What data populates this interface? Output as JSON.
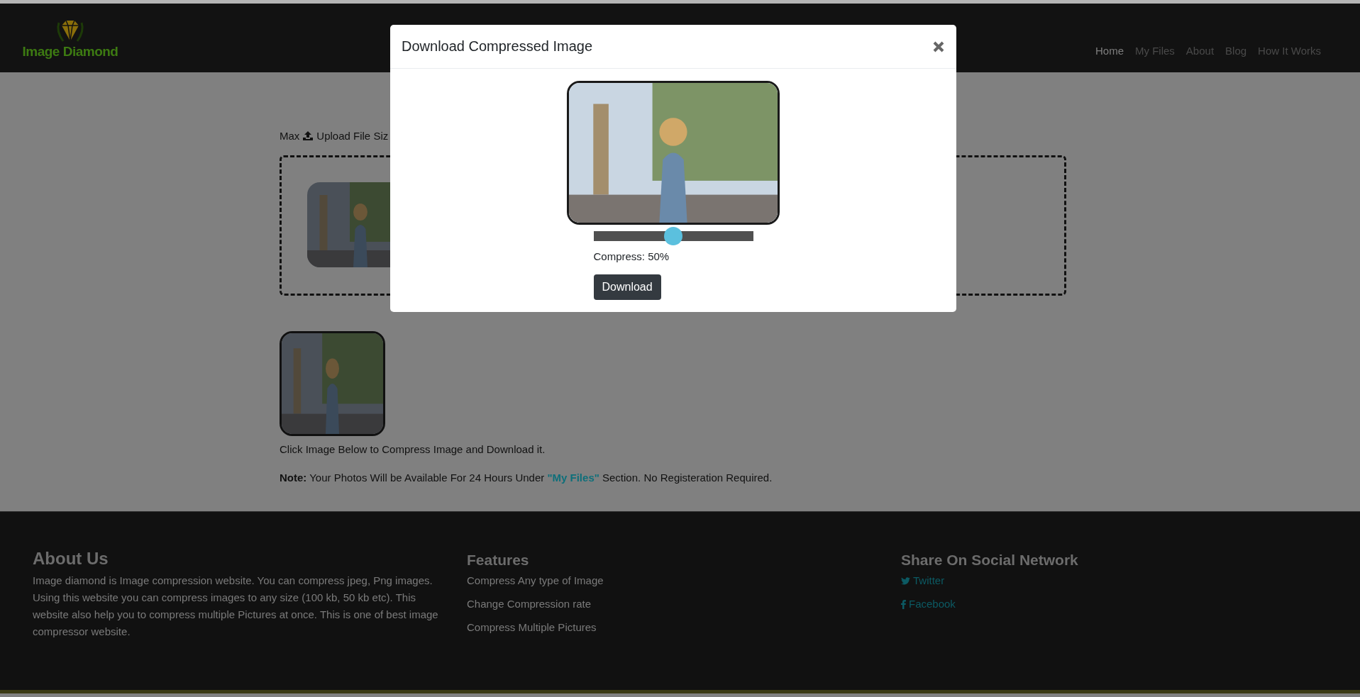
{
  "header": {
    "logo_text": "Image Diamond",
    "nav": [
      {
        "label": "Home",
        "selected": true
      },
      {
        "label": "My Files",
        "selected": false
      },
      {
        "label": "About",
        "selected": false
      },
      {
        "label": "Blog",
        "selected": false
      },
      {
        "label": "How It Works",
        "selected": false
      }
    ]
  },
  "upload": {
    "prefix": "Max",
    "label": "Upload File Siz"
  },
  "instructions": "Click Image Below to Compress Image and Download it.",
  "note": {
    "label": "Note:",
    "before": "Your Photos Will be Available For 24 Hours Under",
    "link": "\"My Files\"",
    "after": "Section. No Registeration Required."
  },
  "modal": {
    "title": "Download Compressed Image",
    "compress": {
      "level": 0.5,
      "label": "Compress: 50%"
    },
    "button": "Download"
  },
  "footer": {
    "about": {
      "heading": "About Us",
      "text": "Image diamond is Image compression website. You can compress jpeg, Png images. Using this website you can compress images to any size (100 kb, 50 kb etc). This website also help you to compress multiple Pictures at once. This is one of best image compressor website."
    },
    "features": {
      "heading": "Features",
      "items": [
        "Compress Any type of Image",
        "Change Compression rate",
        "Compress Multiple Pictures"
      ]
    },
    "social": {
      "heading": "Share On Social Network",
      "links": [
        {
          "kind": "twitter",
          "label": "Twitter"
        },
        {
          "kind": "facebook",
          "label": "Facebook"
        }
      ]
    }
  }
}
